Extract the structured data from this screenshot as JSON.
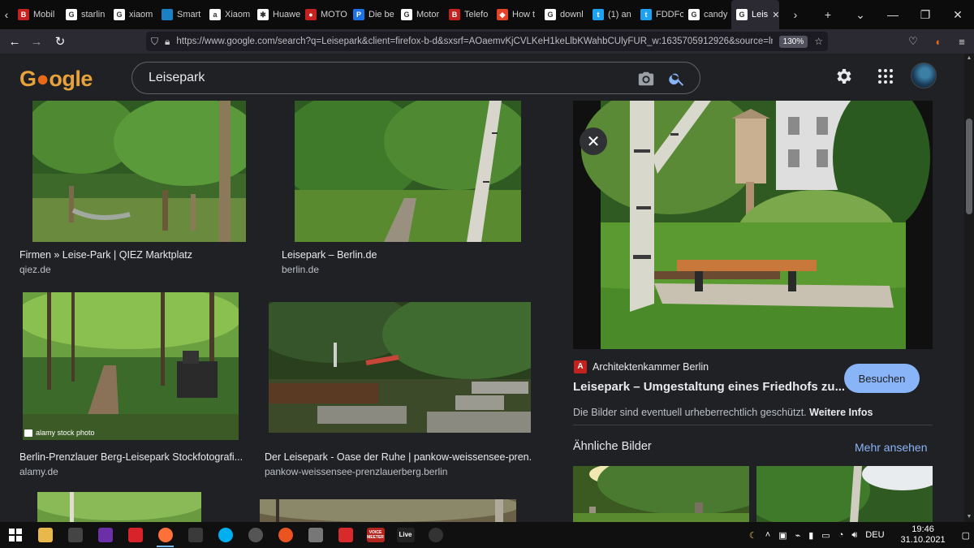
{
  "browser": {
    "tabs": [
      {
        "label": "Mobil",
        "icon": "b-icon",
        "color": "#c5221f",
        "glyph": "B"
      },
      {
        "label": "starlin",
        "icon": "google-icon",
        "color": "#ffffff",
        "glyph": "G"
      },
      {
        "label": "xiaom",
        "icon": "google-icon",
        "color": "#ffffff",
        "glyph": "G"
      },
      {
        "label": "Smart",
        "icon": "square-icon",
        "color": "#1a82c4",
        "glyph": ""
      },
      {
        "label": "Xiaom",
        "icon": "amazon-icon",
        "color": "#ffffff",
        "glyph": "a"
      },
      {
        "label": "Huawe",
        "icon": "huawei-icon",
        "color": "#ffffff",
        "glyph": "✱"
      },
      {
        "label": "MOTO",
        "icon": "moto-icon",
        "color": "#c5221f",
        "glyph": "●"
      },
      {
        "label": "Die be",
        "icon": "p-icon",
        "color": "#1a73e8",
        "glyph": "P"
      },
      {
        "label": "Motor",
        "icon": "google-icon",
        "color": "#ffffff",
        "glyph": "G"
      },
      {
        "label": "Telefo",
        "icon": "b-icon",
        "color": "#c5221f",
        "glyph": "B"
      },
      {
        "label": "How t",
        "icon": "gitlab-icon",
        "color": "#e24329",
        "glyph": "◆"
      },
      {
        "label": "downl",
        "icon": "google-icon",
        "color": "#ffffff",
        "glyph": "G"
      },
      {
        "label": "(1) an",
        "icon": "twitter-icon",
        "color": "#1da1f2",
        "glyph": "t"
      },
      {
        "label": "FDDFo",
        "icon": "twitter-icon",
        "color": "#1da1f2",
        "glyph": "t"
      },
      {
        "label": "candy",
        "icon": "google-icon",
        "color": "#ffffff",
        "glyph": "G"
      },
      {
        "label": "Leis",
        "icon": "google-icon",
        "color": "#ffffff",
        "glyph": "G"
      }
    ],
    "url": "https://www.google.com/search?q=Leisepark&client=firefox-b-d&sxsrf=AOaemvKjCVLKeH1keLlbKWahbCUlyFUR_w:1635705912926&source=lnms&tbm",
    "zoom": "130%"
  },
  "google": {
    "logo": [
      "G",
      "o",
      "o",
      "g",
      "l",
      "e"
    ],
    "query": "Leisepark"
  },
  "results": [
    {
      "title": "Firmen » Leise-Park | QIEZ Marktplatz",
      "domain": "qiez.de"
    },
    {
      "title": "Leisepark – Berlin.de",
      "domain": "berlin.de"
    },
    {
      "title": "Berlin-Prenzlauer Berg-Leisepark Stockfotografi...",
      "domain": "alamy.de",
      "watermark": "alamy stock photo"
    },
    {
      "title": "Der Leisepark - Oase der Ruhe | pankow-weissensee-pren...",
      "domain": "pankow-weissensee-prenzlauerberg.berlin"
    }
  ],
  "preview": {
    "source": "Architektenkammer Berlin",
    "title": "Leisepark – Umgestaltung eines Friedhofs zu...",
    "visit": "Besuchen",
    "copyright": "Die Bilder sind eventuell urheberrechtlich geschützt.",
    "more_info": "Weitere Infos",
    "similar": "Ähnliche Bilder",
    "more": "Mehr ansehen"
  },
  "taskbar": {
    "apps": [
      {
        "name": "file-explorer-icon",
        "color": "#e8b84a"
      },
      {
        "name": "desktop-icon",
        "color": "#444444"
      },
      {
        "name": "app-purple-icon",
        "color": "#6b2fa8"
      },
      {
        "name": "app-red-icon",
        "color": "#d8232a"
      },
      {
        "name": "firefox-icon",
        "color": "#ff7139"
      },
      {
        "name": "app-x-icon",
        "color": "#3a3a3a"
      },
      {
        "name": "skype-icon",
        "color": "#00aff0"
      },
      {
        "name": "app-circle-icon",
        "color": "#555555"
      },
      {
        "name": "ubuntu-icon",
        "color": "#e95420"
      },
      {
        "name": "app-square-icon",
        "color": "#777777"
      },
      {
        "name": "app-pin-icon",
        "color": "#d82a2a"
      },
      {
        "name": "voicemeeter-icon",
        "color": "#b3261e",
        "label": "VOICE MEETER"
      },
      {
        "name": "live-icon",
        "color": "#222222",
        "label": "Live"
      },
      {
        "name": "obs-icon",
        "color": "#333333"
      }
    ],
    "lang": "DEU",
    "time": "19:46",
    "date": "31.10.2021"
  }
}
